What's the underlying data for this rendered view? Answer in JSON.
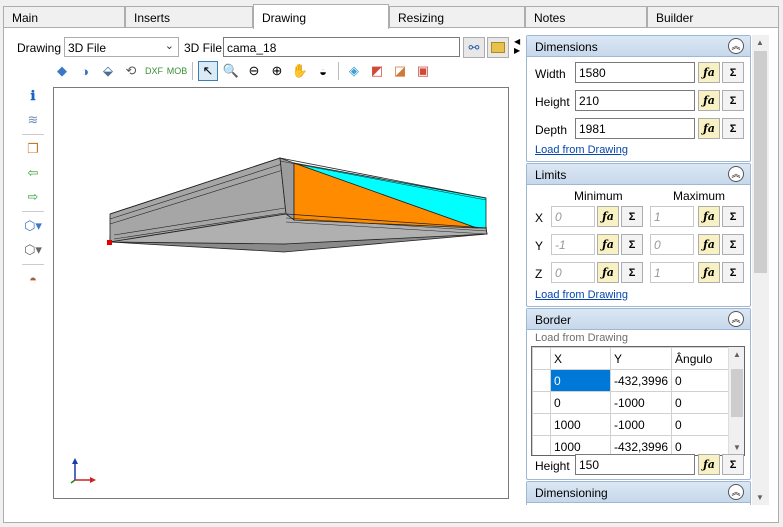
{
  "tabs": [
    "Main",
    "Inserts",
    "Drawing",
    "Resizing",
    "Notes",
    "Builder"
  ],
  "drawing": {
    "label": "Drawing",
    "type_value": "3D File",
    "file_label": "3D File",
    "file_value": "cama_18"
  },
  "dimensions": {
    "title": "Dimensions",
    "width_label": "Width",
    "width_value": "1580",
    "height_label": "Height",
    "height_value": "210",
    "depth_label": "Depth",
    "depth_value": "1981",
    "load_link": "Load from Drawing"
  },
  "limits": {
    "title": "Limits",
    "min_label": "Minimum",
    "max_label": "Maximum",
    "x_label": "X",
    "x_min": "0",
    "x_max": "1",
    "y_label": "Y",
    "y_min": "-1",
    "y_max": "0",
    "z_label": "Z",
    "z_min": "0",
    "z_max": "1",
    "load_link": "Load from Drawing"
  },
  "border": {
    "title": "Border",
    "load_text": "Load from Drawing",
    "columns": [
      "X",
      "Y",
      "Ângulo"
    ],
    "rows": [
      [
        "0",
        "-432,3996",
        "0"
      ],
      [
        "0",
        "-1000",
        "0"
      ],
      [
        "1000",
        "-1000",
        "0"
      ],
      [
        "1000",
        "-432,3996",
        "0"
      ]
    ],
    "height_label": "Height",
    "height_value": "150"
  },
  "dimensioning": {
    "title": "Dimensioning"
  },
  "buttons": {
    "fx": "ƒa",
    "sigma": "Σ"
  },
  "colors": {
    "accent": "#0078d7",
    "bed_orange": "#ff8c00",
    "bed_cyan": "#00ffff",
    "bed_gray": "#a6a6a6"
  }
}
